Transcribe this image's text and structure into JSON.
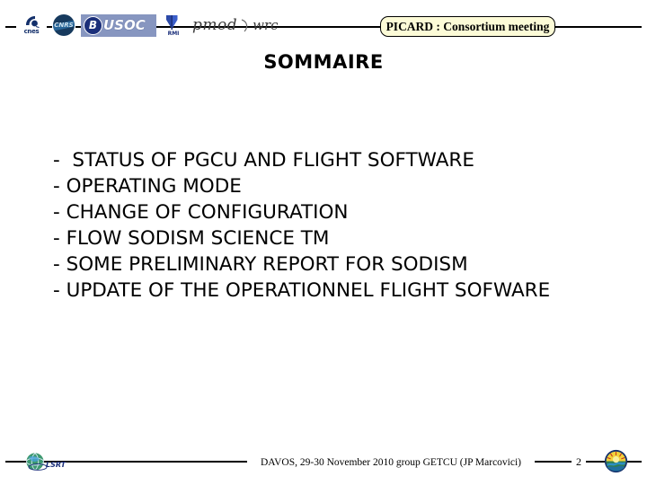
{
  "slide": {
    "header": {
      "banner_label": "PICARD : Consortium meeting",
      "logos": [
        {
          "name": "cnes-logo",
          "text": "cnes"
        },
        {
          "name": "cnrs-logo",
          "text": "CNRS"
        },
        {
          "name": "busoc-logo",
          "badge": "B",
          "text": "USOC"
        },
        {
          "name": "rmi-logo",
          "text": "RMI"
        },
        {
          "name": "pmod-logo",
          "text": "pmod"
        },
        {
          "name": "wrc-logo",
          "text": "wrc"
        }
      ]
    },
    "title": "SOMMAIRE",
    "agenda": [
      "-  STATUS OF PGCU AND FLIGHT SOFTWARE",
      "- OPERATING MODE",
      "- CHANGE OF CONFIGURATION",
      "- FLOW SODISM SCIENCE TM",
      "- SOME PRELIMINARY REPORT FOR SODISM",
      "- UPDATE OF THE OPERATIONNEL FLIGHT SOFWARE"
    ],
    "footer": {
      "left_logo_text": "LSRT",
      "center_text": "DAVOS, 29-30 November 2010 group GETCU (JP Marcovici)",
      "page_number": "2"
    },
    "colors": {
      "banner_fill": "#fcfbd7",
      "banner_border": "#000000",
      "busoc_fill": "#8796c0",
      "cnrs_navy": "#173a5e",
      "text": "#000000",
      "background": "#ffffff"
    }
  }
}
